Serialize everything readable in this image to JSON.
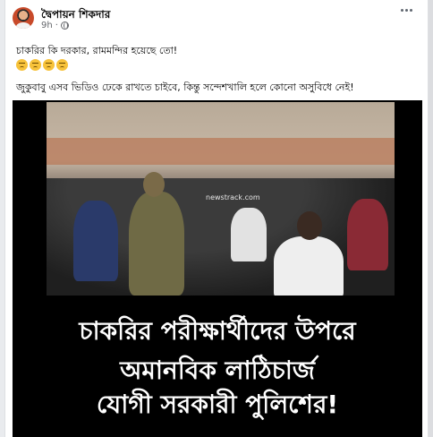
{
  "post": {
    "author": "দ্বৈপায়ন শিকদার",
    "time": "9h",
    "separator": "·",
    "text_line_1": "চাকরির কি দরকার, রামমন্দির হয়েছে তো!",
    "emoji_count": 4,
    "emoji_name": "disappointed-face",
    "text_line_2": "জুকুবাবু এসব ভিডিও ঢেকে রাখতে চাইবে, কিন্তু সন্দেশখালি হলে কোনো অসুবিধে নেই!"
  },
  "media": {
    "video_watermark": "newstrack.com",
    "headline_1": "চাকরির পরীক্ষার্থীদের উপরে",
    "headline_2": "অমানবিক লাঠিচার্জ",
    "headline_3": "যোগী সরকারী পুলিশের!",
    "background_color": "#000000",
    "headline_color": "#ffffff"
  },
  "icons": {
    "privacy": "globe-icon",
    "menu": "more-options-icon"
  }
}
